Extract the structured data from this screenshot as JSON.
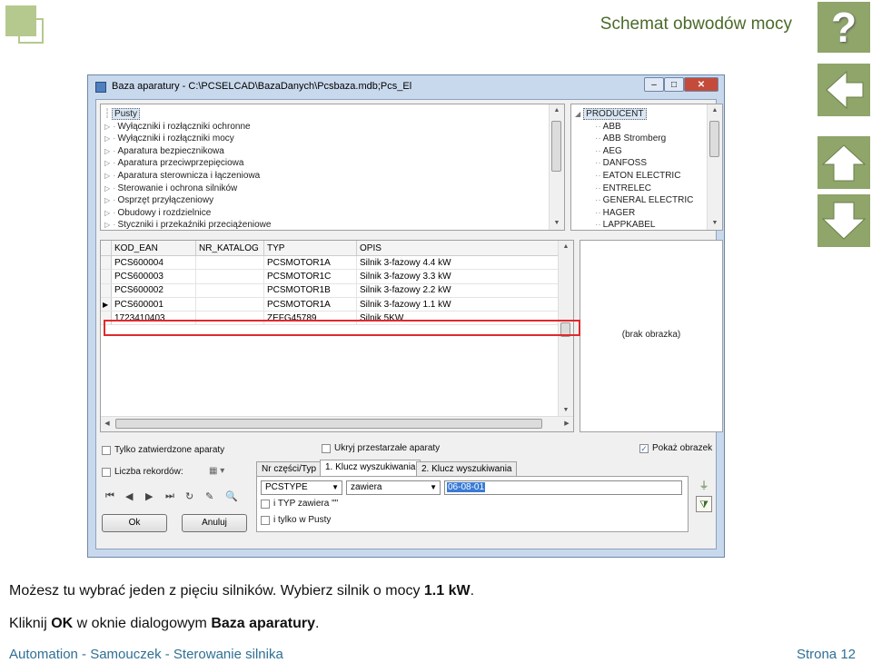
{
  "slide": {
    "title": "Schemat obwodów mocy",
    "help_symbol": "?",
    "instruction1": {
      "pre": "Możesz tu wybrać jeden z pięciu silników. Wybierz silnik o mocy ",
      "bold": "1.1 kW",
      "post": "."
    },
    "instruction2": {
      "pre": "Kliknij ",
      "bold1": "OK",
      "mid": " w oknie dialogowym ",
      "bold2": "Baza aparatury",
      "post": "."
    },
    "footer_left": "Automation - Samouczek - Sterowanie silnika",
    "footer_right": "Strona 12",
    "colors": {
      "accent": "#8fa56a",
      "highlight": "#e0292b",
      "footer": "#2f6f95"
    }
  },
  "dialog": {
    "title": "Baza aparatury - C:\\PCSELCAD\\BazaDanych\\Pcsbaza.mdb;Pcs_El",
    "window_buttons": [
      "–",
      "□",
      "✕"
    ],
    "categories": [
      "Pusty",
      "Wyłączniki i rozłączniki ochronne",
      "Wyłączniki i rozłączniki mocy",
      "Aparatura bezpiecznikowa",
      "Aparatura przeciwprzepięciowa",
      "Aparatura sterownicza i łączeniowa",
      "Sterowanie i ochrona silników",
      "Osprzęt przyłączeniowy",
      "Obudowy i rozdzielnice",
      "Styczniki i przekaźniki przeciążeniowe"
    ],
    "producer_root": "PRODUCENT",
    "producers": [
      "ABB",
      "ABB Stromberg",
      "AEG",
      "DANFOSS",
      "EATON ELECTRIC",
      "ENTRELEC",
      "GENERAL ELECTRIC",
      "HAGER",
      "LAPPKABEL"
    ],
    "grid": {
      "columns": [
        "KOD_EAN",
        "NR_KATALOG",
        "TYP",
        "OPIS"
      ],
      "rows": [
        [
          "PCS600004",
          "",
          "PCSMOTOR1A",
          "Silnik 3-fazowy 4.4 kW"
        ],
        [
          "PCS600003",
          "",
          "PCSMOTOR1C",
          "Silnik 3-fazowy 3.3 kW"
        ],
        [
          "PCS600002",
          "",
          "PCSMOTOR1B",
          "Silnik 3-fazowy 2.2 kW"
        ],
        [
          "PCS600001",
          "",
          "PCSMOTOR1A",
          "Silnik 3-fazowy 1.1 kW"
        ],
        [
          "1723410403",
          "",
          "ZEFG45789",
          "Silnik 5KW"
        ]
      ],
      "current_row_marker": "▶"
    },
    "no_image": "(brak obrazka)",
    "options": {
      "only_approved": "Tylko zatwierdzone aparaty",
      "hide_obsolete": "Ukryj przestarzałe aparaty",
      "show_image": "Pokaż obrazek",
      "show_image_checked": "✓",
      "record_count": "Liczba rekordów:"
    },
    "tabs": [
      "Nr części/Typ",
      "1. Klucz wyszukiwania",
      "2. Klucz wyszukiwania"
    ],
    "search": {
      "field": "PCSTYPE",
      "operator": "zawiera",
      "value": "06-08-01",
      "and_type": "i TYP zawiera \"\"",
      "only_empty": "i tylko w Pusty"
    },
    "nav_icons": [
      "⏮",
      "◀",
      "▶",
      "⏭",
      "↻",
      "✎",
      "🔍"
    ],
    "buttons": {
      "ok": "Ok",
      "cancel": "Anuluj"
    }
  }
}
